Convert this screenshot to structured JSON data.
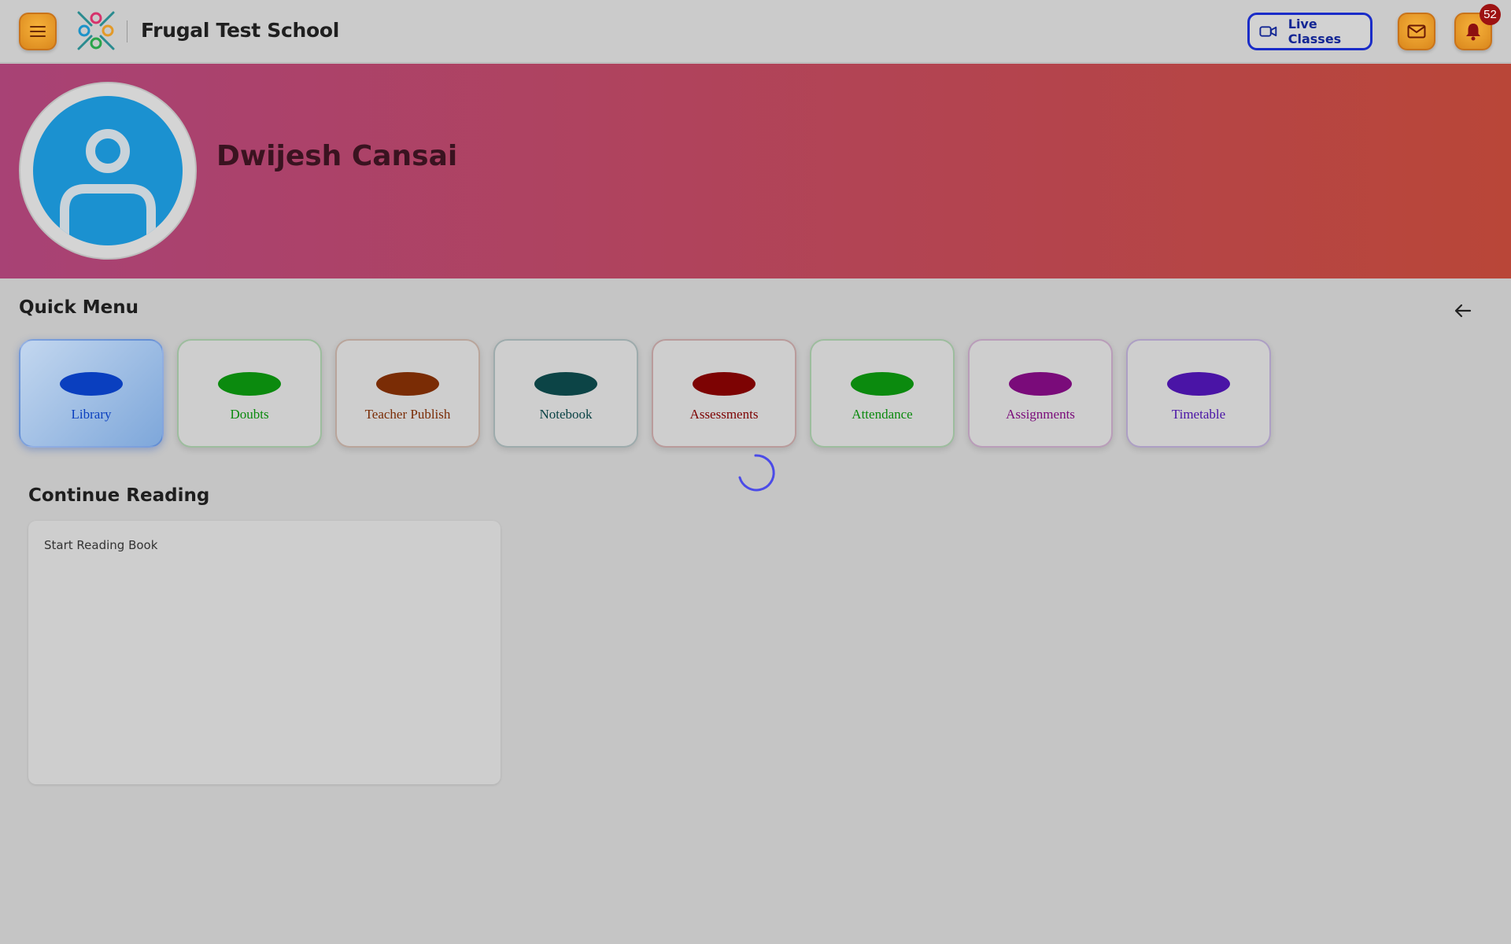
{
  "header": {
    "school_name": "Frugal Test School",
    "live_classes_label": "Live Classes",
    "notification_count": "52",
    "icons": {
      "menu": "hamburger-icon",
      "live": "video-camera-icon",
      "mail": "mail-icon",
      "bell": "bell-icon"
    }
  },
  "profile": {
    "name": "Dwijesh Cansai",
    "avatar_icon": "user-icon"
  },
  "quick_menu": {
    "title": "Quick Menu",
    "back_icon": "arrow-left-icon",
    "items": [
      {
        "label": "Library",
        "color": "#0a3fbf",
        "active": true
      },
      {
        "label": "Doubts",
        "color": "#0b8a0e"
      },
      {
        "label": "Teacher Publish",
        "color": "#7a2c05"
      },
      {
        "label": "Notebook",
        "color": "#0c4446"
      },
      {
        "label": "Assessments",
        "color": "#7d0303"
      },
      {
        "label": "Attendance",
        "color": "#0b8a0e"
      },
      {
        "label": "Assignments",
        "color": "#7a0b7a"
      },
      {
        "label": "Timetable",
        "color": "#4a14a6"
      }
    ]
  },
  "continue_reading": {
    "title": "Continue Reading",
    "card_text": "Start Reading Book"
  },
  "colors": {
    "accent_orange": "#e39a28",
    "live_blue": "#1a2cc8",
    "banner_start": "#a84275",
    "banner_end": "#b94638",
    "spinner": "#4b4be8"
  }
}
